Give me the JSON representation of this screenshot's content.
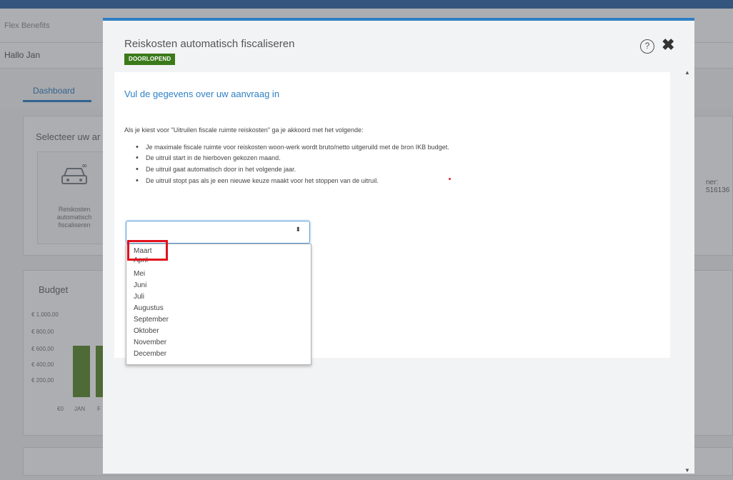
{
  "background": {
    "brand": "Flex Benefits",
    "greeting": "Hallo Jan",
    "tab_dashboard": "Dashboard",
    "select_title": "Selecteer uw ar",
    "tile_label": "Reiskosten automatisch fiscaliseren",
    "right_text": "ner: 516136",
    "budget_title": "Budget",
    "budget_axis": [
      "€ 1.000,00",
      "€ 800,00",
      "€ 600,00",
      "€ 400,00",
      "€ 200,00"
    ],
    "budget_x_labels": [
      "€0",
      "JAN",
      "F"
    ]
  },
  "modal": {
    "title": "Reiskosten automatisch fiscaliseren",
    "status_badge": "DOORLOPEND",
    "help_icon": "?",
    "close_icon": "✖",
    "form_heading": "Vul de gegevens over uw aanvraag in",
    "intro": "Als je kiest voor \"Uitruilen fiscale ruimte reiskosten\" ga je akkoord met het volgende:",
    "bullets": [
      "Je maximale fiscale ruimte voor reiskosten woon-werk wordt bruto/netto uitgeruild met de bron IKB budget.",
      "De uitruil start in de hierboven gekozen maand.",
      "De uitruil gaat automatisch door in het volgende jaar.",
      "De uitruil stopt pas als je een nieuwe keuze maakt voor het stoppen van de uitruil."
    ],
    "select": {
      "value": "",
      "arrows": "⬍",
      "options": [
        "Maart",
        "April",
        "Mei",
        "Juni",
        "Juli",
        "Augustus",
        "September",
        "Oktober",
        "November",
        "December"
      ]
    }
  },
  "colors": {
    "accent": "#2f7fc4",
    "badge": "#3b7a1a",
    "highlight": "#e3101d"
  }
}
